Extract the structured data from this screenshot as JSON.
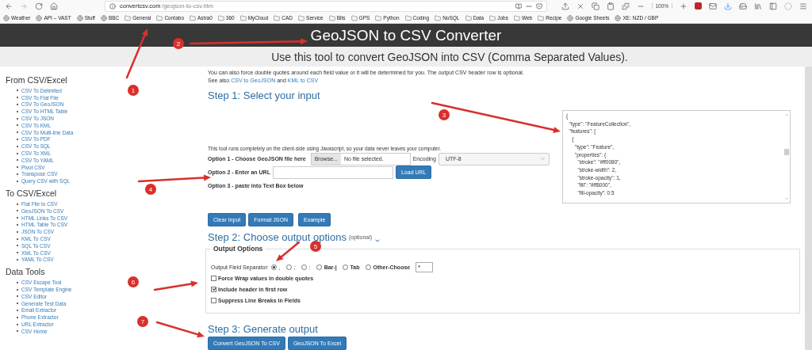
{
  "browser": {
    "url_domain": "convertcsv.com",
    "url_path": "/geojson-to-csv.htm",
    "zoom": "100%",
    "bookmarks": [
      {
        "label": "Weather",
        "kind": "site"
      },
      {
        "label": "API – VAST",
        "kind": "site"
      },
      {
        "label": "Stuff",
        "kind": "site"
      },
      {
        "label": "BBC",
        "kind": "site"
      },
      {
        "label": "General",
        "kind": "folder"
      },
      {
        "label": "Contabo",
        "kind": "folder"
      },
      {
        "label": "Astra0",
        "kind": "folder"
      },
      {
        "label": "360",
        "kind": "folder"
      },
      {
        "label": "MyCloud",
        "kind": "folder"
      },
      {
        "label": "CAD",
        "kind": "folder"
      },
      {
        "label": "Service",
        "kind": "folder"
      },
      {
        "label": "Bits",
        "kind": "folder"
      },
      {
        "label": "GPS",
        "kind": "folder"
      },
      {
        "label": "Python",
        "kind": "folder"
      },
      {
        "label": "Coding",
        "kind": "folder"
      },
      {
        "label": "NoSQL",
        "kind": "folder"
      },
      {
        "label": "Data",
        "kind": "folder"
      },
      {
        "label": "Jobs",
        "kind": "folder"
      },
      {
        "label": "Web",
        "kind": "folder"
      },
      {
        "label": "Recipe",
        "kind": "folder"
      },
      {
        "label": "Google Sheets",
        "kind": "site"
      },
      {
        "label": "XE: NZD / GBP",
        "kind": "site"
      }
    ]
  },
  "header": {
    "title": "GeoJSON to CSV Converter",
    "subtitle": "Use this tool to convert GeoJSON into CSV (Comma Separated Values)."
  },
  "sidebar": {
    "sections": [
      {
        "heading": "From CSV/Excel",
        "items": [
          "CSV To Delimited",
          "CSV To Flat File",
          "CSV To GeoJSON",
          "CSV To HTML Table",
          "CSV To JSON",
          "CSV To KML",
          "CSV To Multi-line Data",
          "CSV To PDF",
          "CSV To SQL",
          "CSV To XML",
          "CSV To YAML",
          "Pivot CSV",
          "Transpose CSV",
          "Query CSV with SQL"
        ]
      },
      {
        "heading": "To CSV/Excel",
        "items": [
          "Flat File to CSV",
          "GeoJSON To CSV",
          "HTML Links To CSV",
          "HTML Table To CSV",
          "JSON To CSV",
          "KML To CSV",
          "SQL To CSV",
          "XML To CSV",
          "YAML To CSV"
        ]
      },
      {
        "heading": "Data Tools",
        "items": [
          "CSV Escape Tool",
          "CSV Template Engine",
          "CSV Editor",
          "Generate Test Data",
          "Email Extractor",
          "Phone Extractor",
          "URL Extractor",
          "CSV Home"
        ]
      }
    ]
  },
  "intro": {
    "text": "You can also force double quotes around each field value or it will be determined for you. The output CSV header row is optional.",
    "see_also": [
      {
        "kind": "text",
        "text": "See also"
      },
      {
        "kind": "link",
        "text": "CSV to GeoJSON"
      },
      {
        "kind": "text",
        "text": "and"
      },
      {
        "kind": "link",
        "text": "KML to CSV"
      }
    ]
  },
  "step1": {
    "title": "Step 1: Select your input",
    "note": "This tool runs completely on the client-side using Javascript, so your data never leaves your computer.",
    "option1": {
      "label": "Option 1 - Choose GeoJSON file here",
      "browse": "Browse...",
      "file_status": "No file selected.",
      "encoding_label": "Encoding",
      "encoding": "UTF-8"
    },
    "option2": {
      "label": "Option 2 - Enter an URL",
      "button": "Load URL"
    },
    "option3": {
      "label": "Option 3 - paste into Text Box below"
    },
    "input_lines": [
      "{",
      "  \"type\": \"FeatureCollection\",",
      "  \"features\": [",
      "    {",
      "      \"type\": \"Feature\",",
      "      \"properties\": {",
      "        \"stroke\": \"#ff0080\",",
      "        \"stroke-width\": 2,",
      "        \"stroke-opacity\": 1,",
      "        \"fill\": \"#ff8000\",",
      "        \"fill-opacity\": 0.5"
    ],
    "buttons": [
      "Clear Input",
      "Format JSON",
      "Example"
    ]
  },
  "step2": {
    "title": "Step 2: Choose output options",
    "optional": "(optional)",
    "legend": "Output Options",
    "separator_label": "Output Field Separator:",
    "separators": [
      {
        "label": ",",
        "kind": "symbol",
        "selected": true
      },
      {
        "label": ";",
        "kind": "symbol",
        "selected": false
      },
      {
        "label": ":",
        "kind": "symbol",
        "selected": false
      },
      {
        "label": "Bar-|",
        "kind": "word",
        "selected": false
      },
      {
        "label": "Tab",
        "kind": "word",
        "selected": false
      },
      {
        "label": "Other-Choose",
        "kind": "word",
        "selected": false
      }
    ],
    "other_value": "*",
    "checkboxes": [
      {
        "label": "Force Wrap values in double quotes",
        "checked": false
      },
      {
        "label": "Include header in first row",
        "checked": true
      },
      {
        "label": "Suppress Line Breaks in Fields",
        "checked": false
      }
    ]
  },
  "step3": {
    "title": "Step 3: Generate output",
    "buttons": [
      "Convert GeoJSON To CSV",
      "GeoJSON To Excel"
    ]
  },
  "annotations": [
    {
      "label": "1"
    },
    {
      "label": "2"
    },
    {
      "label": "3"
    },
    {
      "label": "4"
    },
    {
      "label": "5"
    },
    {
      "label": "6"
    },
    {
      "label": "7"
    }
  ]
}
